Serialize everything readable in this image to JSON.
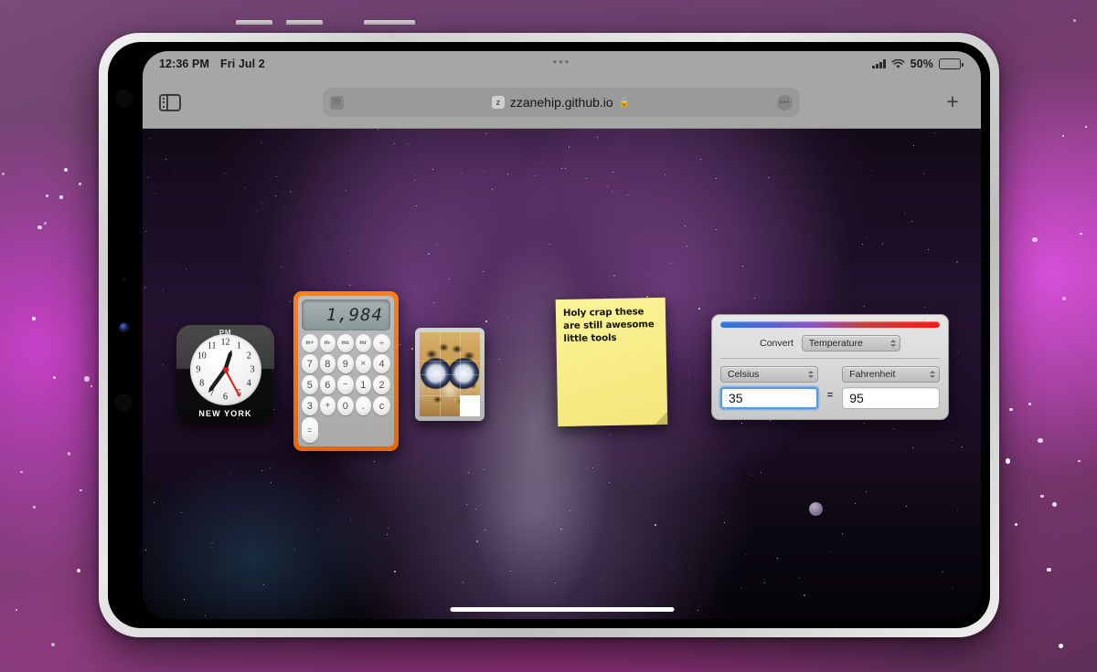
{
  "status_bar": {
    "time": "12:36 PM",
    "date": "Fri Jul 2",
    "battery_percent": "50%",
    "cellular_icon": "cellular-signal-icon",
    "wifi_icon": "wifi-icon",
    "battery_icon": "battery-icon"
  },
  "toolbar": {
    "sidebar_icon": "sidebar-toggle-icon",
    "tab_close_label": "☒",
    "favicon_letter": "z",
    "url": "zzanehip.github.io",
    "lock_icon": "🔒",
    "more_label": "•••",
    "new_tab_label": "+",
    "grabber_label": "•••"
  },
  "clock": {
    "meridiem": "PM",
    "city": "NEW YORK",
    "hours": [
      "12",
      "1",
      "2",
      "3",
      "4",
      "5",
      "6",
      "7",
      "8",
      "9",
      "10",
      "11"
    ],
    "hour_angle_deg": 18,
    "minute_angle_deg": 216,
    "second_angle_deg": 152
  },
  "calculator": {
    "display": "1,984",
    "keys": [
      {
        "label": "m+",
        "type": "mem"
      },
      {
        "label": "m-",
        "type": "mem"
      },
      {
        "label": "mc",
        "type": "mem"
      },
      {
        "label": "mr",
        "type": "mem"
      },
      {
        "label": "÷",
        "type": "op"
      },
      {
        "label": "7",
        "type": "num"
      },
      {
        "label": "8",
        "type": "num"
      },
      {
        "label": "9",
        "type": "num"
      },
      {
        "label": "×",
        "type": "op"
      },
      {
        "label": "4",
        "type": "num"
      },
      {
        "label": "5",
        "type": "num"
      },
      {
        "label": "6",
        "type": "num"
      },
      {
        "label": "−",
        "type": "op"
      },
      {
        "label": "1",
        "type": "num"
      },
      {
        "label": "2",
        "type": "num"
      },
      {
        "label": "3",
        "type": "num"
      },
      {
        "label": "+",
        "type": "op"
      },
      {
        "label": "0",
        "type": "num"
      },
      {
        "label": ".",
        "type": "num"
      },
      {
        "label": "c",
        "type": "num"
      },
      {
        "label": "=",
        "type": "eq"
      }
    ]
  },
  "puzzle": {
    "image_subject": "leopard-face-photo",
    "blank_tile": "empty-tile"
  },
  "sticky_note": {
    "text": "Holy crap these are still awesome little tools"
  },
  "converter": {
    "convert_label": "Convert",
    "category": "Temperature",
    "from_unit": "Celsius",
    "from_value": "35",
    "equals": "=",
    "to_unit": "Fahrenheit",
    "to_value": "95"
  },
  "colors": {
    "accent_orange": "#ff7f11",
    "note_yellow": "#f8ee8a",
    "focus_blue": "#4d9ae8",
    "chrome_gray": "#a6a6a6",
    "clock_red": "#e01a1a"
  }
}
